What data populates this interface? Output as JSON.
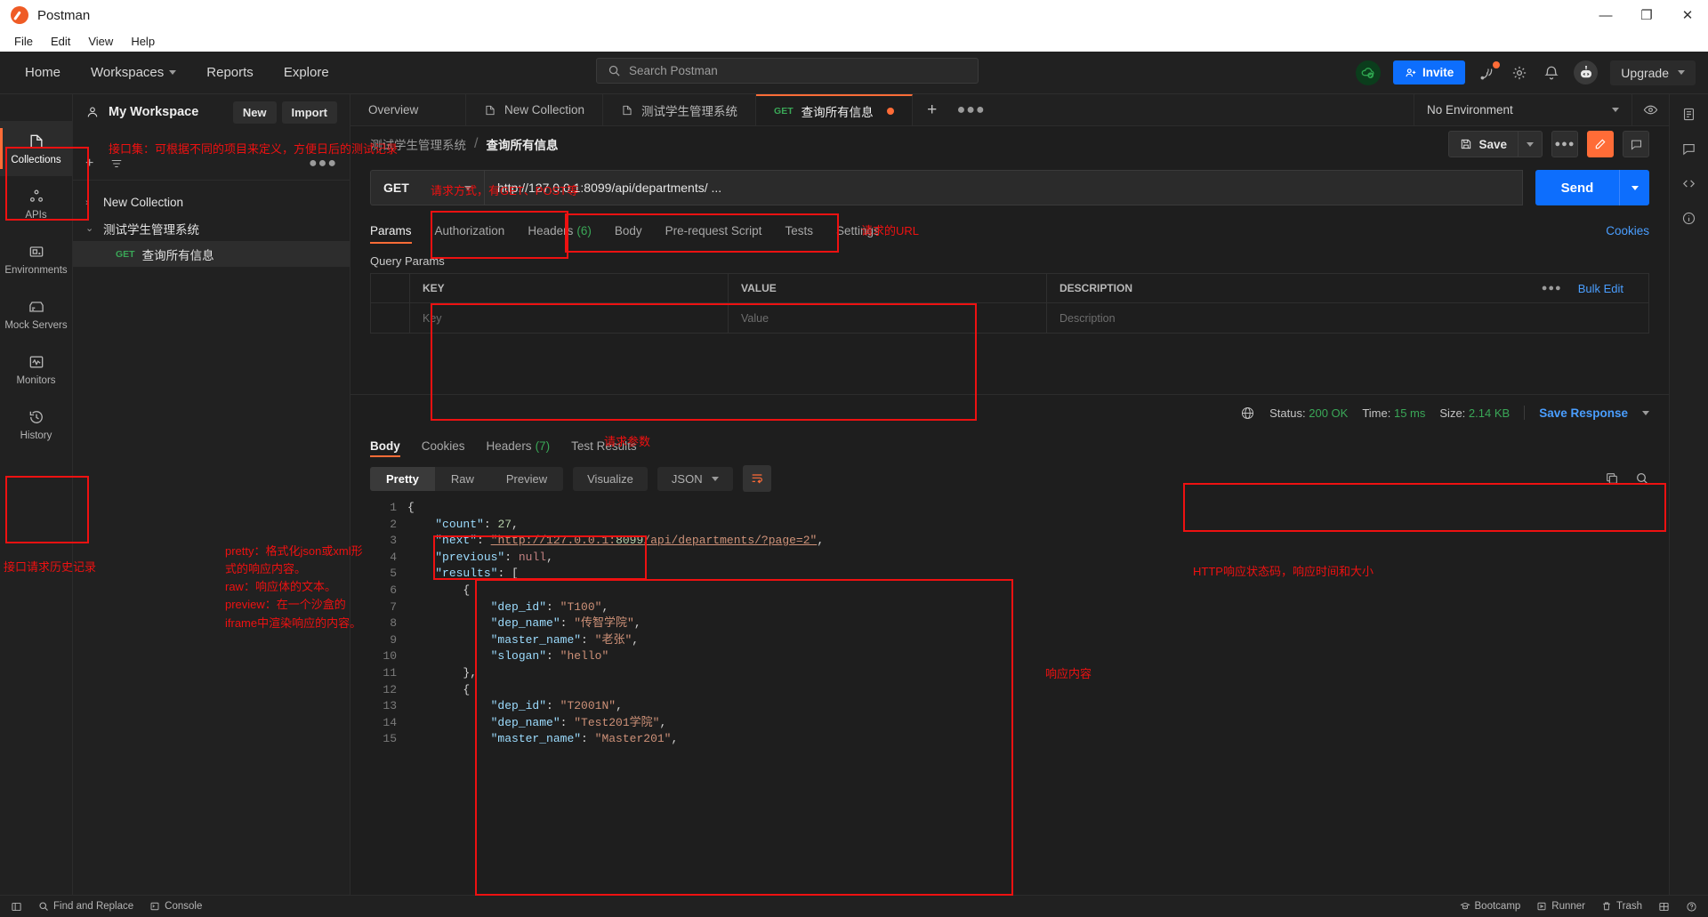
{
  "window": {
    "app_title": "Postman",
    "menu": [
      "File",
      "Edit",
      "View",
      "Help"
    ],
    "controls": {
      "minimize": "—",
      "maximize": "❐",
      "close": "✕"
    }
  },
  "header": {
    "nav": [
      "Home",
      "Workspaces",
      "Reports",
      "Explore"
    ],
    "search_placeholder": "Search Postman",
    "invite_label": "Invite",
    "upgrade_label": "Upgrade",
    "icons": [
      "cloud-check-icon",
      "satellite-icon",
      "gear-icon",
      "bell-icon",
      "bot-icon"
    ]
  },
  "sidebar": {
    "workspace_icon": "user-icon",
    "workspace_name": "My Workspace",
    "new_label": "New",
    "import_label": "Import",
    "tools": [
      "plus-icon",
      "filter-icon",
      "more-icon"
    ],
    "tree": [
      {
        "label": "New Collection",
        "chevron": "›",
        "type": "collection",
        "selected": false
      },
      {
        "label": "测试学生管理系统",
        "chevron": "⌄",
        "type": "collection",
        "selected": false
      },
      {
        "label": "查询所有信息",
        "method": "GET",
        "type": "request",
        "selected": true
      }
    ]
  },
  "rail": {
    "items": [
      {
        "label": "Collections",
        "icon": "collections-icon",
        "active": true
      },
      {
        "label": "APIs",
        "icon": "apis-icon",
        "active": false
      },
      {
        "label": "Environments",
        "icon": "environments-icon",
        "active": false
      },
      {
        "label": "Mock Servers",
        "icon": "mock-servers-icon",
        "active": false
      },
      {
        "label": "Monitors",
        "icon": "monitors-icon",
        "active": false
      },
      {
        "label": "History",
        "icon": "history-icon",
        "active": false
      }
    ]
  },
  "tabs": {
    "items": [
      {
        "label": "Overview",
        "icon": "",
        "active": false,
        "unsaved": false
      },
      {
        "label": "New Collection",
        "icon": "collection-icon",
        "active": false,
        "unsaved": false
      },
      {
        "label": "测试学生管理系统",
        "icon": "collection-icon",
        "active": false,
        "unsaved": false
      },
      {
        "label": "查询所有信息",
        "method": "GET",
        "active": true,
        "unsaved": true
      }
    ],
    "plus": "+",
    "dots": "●●●",
    "environment": "No Environment",
    "eye_icon": "eye-icon"
  },
  "request": {
    "breadcrumb_parent": "测试学生管理系统",
    "breadcrumb_sep": "/",
    "breadcrumb_current": "查询所有信息",
    "save_label": "Save",
    "method": "GET",
    "url": "http://127.0.0.1:8099/api/departments/ ...",
    "send_label": "Send",
    "tabs": [
      {
        "label": "Params",
        "active": true,
        "count": ""
      },
      {
        "label": "Authorization",
        "active": false,
        "count": ""
      },
      {
        "label": "Headers",
        "active": false,
        "count": "(6)"
      },
      {
        "label": "Body",
        "active": false,
        "count": ""
      },
      {
        "label": "Pre-request Script",
        "active": false,
        "count": ""
      },
      {
        "label": "Tests",
        "active": false,
        "count": ""
      },
      {
        "label": "Settings",
        "active": false,
        "count": ""
      }
    ],
    "cookies_link": "Cookies",
    "query_params": {
      "title": "Query Params",
      "columns": [
        "KEY",
        "VALUE",
        "DESCRIPTION"
      ],
      "bulk_edit": "Bulk Edit",
      "dots": "●●●",
      "rows": [
        {
          "key": "Key",
          "value": "Value",
          "description": "Description",
          "placeholder": true
        }
      ]
    }
  },
  "response": {
    "status_label": "Status:",
    "status_value": "200 OK",
    "time_label": "Time:",
    "time_value": "15 ms",
    "size_label": "Size:",
    "size_value": "2.14 KB",
    "save_response": "Save Response",
    "tabs": [
      {
        "label": "Body",
        "active": true,
        "count": ""
      },
      {
        "label": "Cookies",
        "active": false,
        "count": ""
      },
      {
        "label": "Headers",
        "active": false,
        "count": "(7)"
      },
      {
        "label": "Test Results",
        "active": false,
        "count": ""
      }
    ],
    "format_modes": [
      {
        "label": "Pretty",
        "active": true
      },
      {
        "label": "Raw",
        "active": false
      },
      {
        "label": "Preview",
        "active": false
      }
    ],
    "visualize_label": "Visualize",
    "language": "JSON",
    "wrap_icon": "wrap-lines-icon",
    "copy_icon": "copy-icon",
    "search_icon": "search-icon",
    "body_lines": [
      {
        "n": 1,
        "text": "{"
      },
      {
        "n": 2,
        "text": "    \"count\": 27,"
      },
      {
        "n": 3,
        "text": "    \"next\": \"http://127.0.0.1:8099/api/departments/?page=2\","
      },
      {
        "n": 4,
        "text": "    \"previous\": null,"
      },
      {
        "n": 5,
        "text": "    \"results\": ["
      },
      {
        "n": 6,
        "text": "        {"
      },
      {
        "n": 7,
        "text": "            \"dep_id\": \"T100\","
      },
      {
        "n": 8,
        "text": "            \"dep_name\": \"传智学院\","
      },
      {
        "n": 9,
        "text": "            \"master_name\": \"老张\","
      },
      {
        "n": 10,
        "text": "            \"slogan\": \"hello\""
      },
      {
        "n": 11,
        "text": "        },"
      },
      {
        "n": 12,
        "text": "        {"
      },
      {
        "n": 13,
        "text": "            \"dep_id\": \"T2001N\","
      },
      {
        "n": 14,
        "text": "            \"dep_name\": \"Test201学院\","
      },
      {
        "n": 15,
        "text": "            \"master_name\": \"Master201\","
      }
    ]
  },
  "annotations": {
    "collections": "接口集：可根据不同的项目来定义，方便日后的测试记录",
    "history": "接口请求历史记录",
    "method": "请求方式，有GET、POST等",
    "url": "请求的URL",
    "params": "请求参数",
    "status": "HTTP响应状态码，响应时间和大小",
    "body": "响应内容",
    "formats": "pretty：格式化json或xml形\n式的响应内容。\nraw：响应体的文本。\npreview：在一个沙盒的\niframe中渲染响应的内容。"
  },
  "bottombar": {
    "left": [
      {
        "label": "Find and Replace",
        "icon": "search-icon"
      },
      {
        "label": "Console",
        "icon": "console-icon"
      }
    ],
    "right": [
      {
        "label": "Bootcamp",
        "icon": "bootcamp-icon"
      },
      {
        "label": "Runner",
        "icon": "runner-icon"
      },
      {
        "label": "Trash",
        "icon": "trash-icon"
      }
    ],
    "panel_icon": "layout-icon",
    "help_icon": "help-icon"
  }
}
